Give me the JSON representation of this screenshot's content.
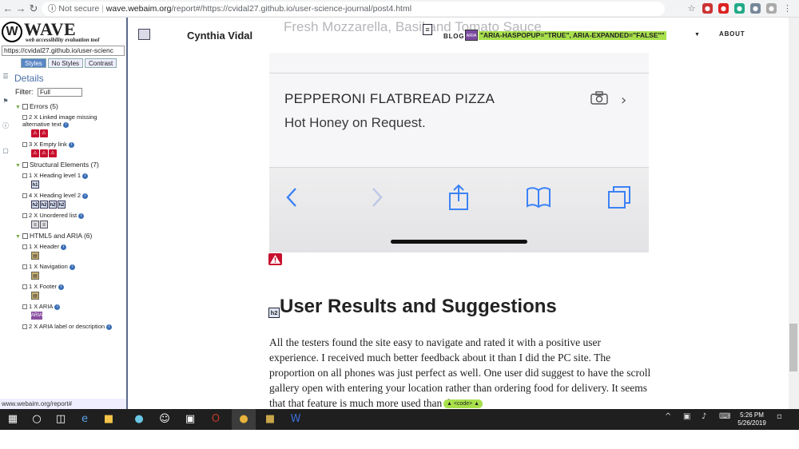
{
  "browser": {
    "security_label": "Not secure",
    "url_host": "wave.webaim.org",
    "url_path": "/report#/https://cvidal27.github.io/user-science-journal/post4.html"
  },
  "wave": {
    "logo_word": "WAVE",
    "logo_letter": "W",
    "tagline": "web accessibility evaluation tool",
    "url_value": "https://cvidal27.github.io/user-scienc",
    "tabs": [
      "Styles",
      "No Styles",
      "Contrast"
    ],
    "details_heading": "Details",
    "filter_label": "Filter:",
    "filter_value": "Full",
    "categories": {
      "errors": "Errors (5)",
      "structural": "Structural Elements (7)",
      "html5": "HTML5 and ARIA (6)"
    },
    "items": {
      "missing_alt": "2 X Linked image missing alternative text",
      "empty_link": "3 X Empty link",
      "heading1": "1 X Heading level 1",
      "heading2": "4 X Heading level 2",
      "ul": "2 X Unordered list",
      "header": "1 X Header",
      "navigation": "1 X Navigation",
      "footer": "1 X Footer",
      "aria": "1 X ARIA",
      "aria_label": "2 X ARIA label or description"
    },
    "badge_h1": "h1",
    "badge_h2": "h2",
    "badge_aria": "ARIA",
    "status_text": "www.webaim.org/report#"
  },
  "site": {
    "name": "Cynthia Vidal",
    "nav": {
      "blog": "BLOG",
      "aria_badge": "ARIA",
      "aria_attrs": "\"ARIA-HASPOPUP=\"TRUE\", ARIA-EXPANDED=\"FALSE\"\"",
      "about": "ABOUT"
    },
    "caption_partial": "Fresh Mozzarella, Basil and Tomato Sauce",
    "pizza_title": "PEPPERONI FLATBREAD PIZZA",
    "pizza_sub": "Hot Honey on Request.",
    "h2_badge": "h2",
    "section_title": "User Results and Suggestions",
    "body": "All the testers found the site easy to navigate and rated it with a positive user experience. I received much better feedback about it than I did the PC site. The proportion on all phones was just perfect as well. One user did suggest to have the scroll gallery open with entering your location rather than ordering food for delivery. It seems that that feature is much more used than the",
    "code_tag": "▲ <code> ▲"
  },
  "taskbar": {
    "time": "5:26 PM",
    "date": "5/26/2019"
  }
}
